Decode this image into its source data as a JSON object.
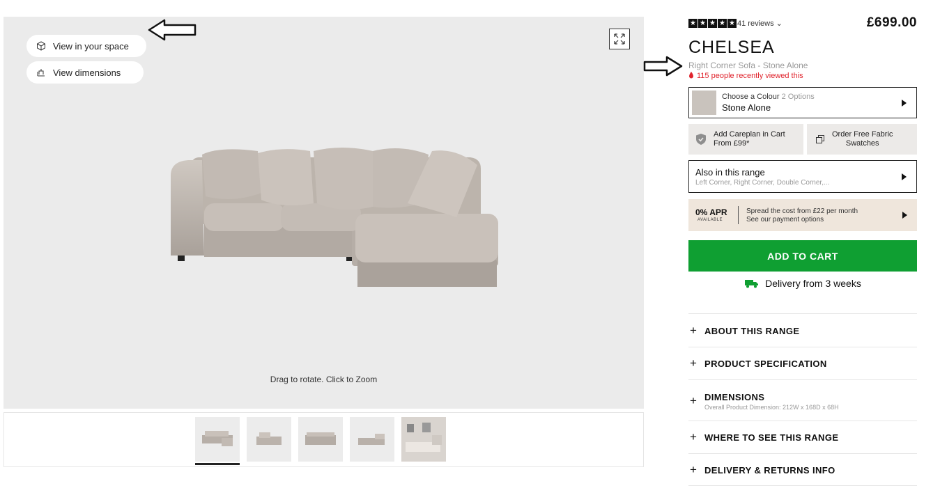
{
  "viewer": {
    "view_in_space": "View in your space",
    "view_dimensions": "View dimensions",
    "hint": "Drag to rotate. Click to Zoom"
  },
  "thumbnails": [
    "sofa-front",
    "sofa-side",
    "sofa-back",
    "sofa-angle",
    "sofa-room"
  ],
  "product": {
    "rating": 5,
    "reviews": "41 reviews ⌄",
    "price": "£699.00",
    "title": "CHELSEA",
    "subtitle": "Right Corner Sofa - Stone Alone",
    "viewed": "115 people recently viewed this"
  },
  "colour": {
    "label": "Choose a Colour",
    "options": "2 Options",
    "value": "Stone Alone",
    "swatch_color": "#c9c3bd"
  },
  "careplan": {
    "line1": "Add Careplan in Cart",
    "line2": "From £99*"
  },
  "swatches": {
    "line1": "Order Free Fabric",
    "line2": "Swatches"
  },
  "range": {
    "title": "Also in this range",
    "list": "Left Corner, Right Corner, Double Corner,..."
  },
  "apr": {
    "big": "0% APR",
    "small": "AVAILABLE",
    "line1": "Spread the cost from £22 per month",
    "line2": "See our payment options"
  },
  "cart": {
    "label": "ADD TO CART",
    "delivery": "Delivery from 3 weeks",
    "accent": "#0f9f32"
  },
  "accordion": [
    {
      "label": "ABOUT THIS RANGE"
    },
    {
      "label": "PRODUCT SPECIFICATION"
    },
    {
      "label": "DIMENSIONS",
      "sub": "Overall Product Dimension: 212W x 168D x 68H"
    },
    {
      "label": "WHERE TO SEE THIS RANGE"
    },
    {
      "label": "DELIVERY & RETURNS INFO"
    }
  ]
}
